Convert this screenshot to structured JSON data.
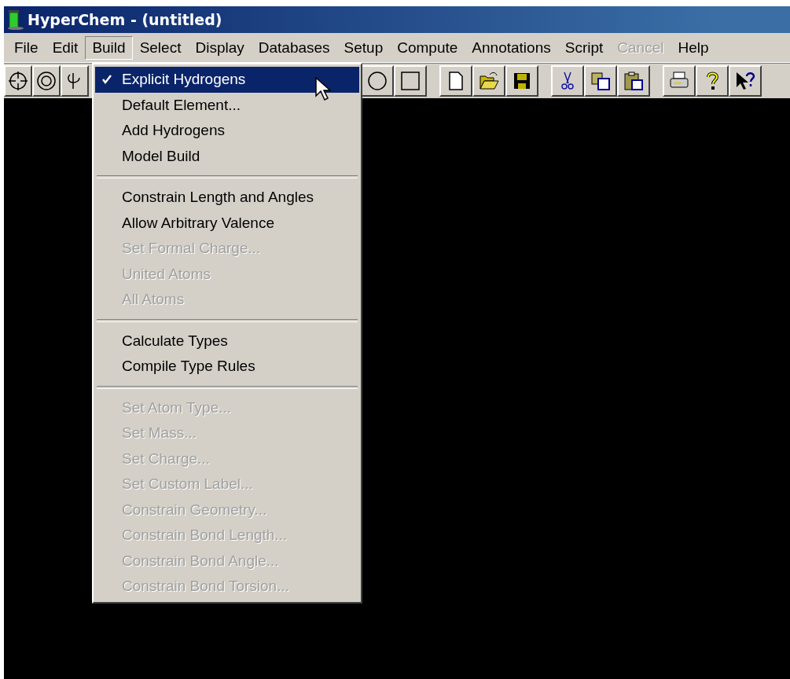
{
  "window": {
    "title": "HyperChem - (untitled)"
  },
  "menubar": [
    {
      "label": "File",
      "selected": false,
      "disabled": false
    },
    {
      "label": "Edit",
      "selected": false,
      "disabled": false
    },
    {
      "label": "Build",
      "selected": true,
      "disabled": false
    },
    {
      "label": "Select",
      "selected": false,
      "disabled": false
    },
    {
      "label": "Display",
      "selected": false,
      "disabled": false
    },
    {
      "label": "Databases",
      "selected": false,
      "disabled": false
    },
    {
      "label": "Setup",
      "selected": false,
      "disabled": false
    },
    {
      "label": "Compute",
      "selected": false,
      "disabled": false
    },
    {
      "label": "Annotations",
      "selected": false,
      "disabled": false
    },
    {
      "label": "Script",
      "selected": false,
      "disabled": false
    },
    {
      "label": "Cancel",
      "selected": false,
      "disabled": true
    },
    {
      "label": "Help",
      "selected": false,
      "disabled": false
    }
  ],
  "toolbar": {
    "groups": [
      [
        {
          "kind": "crosshair"
        },
        {
          "kind": "rings"
        },
        {
          "kind": "hook"
        }
      ],
      [
        {
          "kind": "circle"
        },
        {
          "kind": "square"
        }
      ],
      [
        {
          "kind": "new"
        },
        {
          "kind": "open"
        },
        {
          "kind": "save"
        }
      ],
      [
        {
          "kind": "cut"
        },
        {
          "kind": "copy"
        },
        {
          "kind": "paste"
        }
      ],
      [
        {
          "kind": "print"
        },
        {
          "kind": "help"
        },
        {
          "kind": "context-help"
        }
      ]
    ]
  },
  "build_menu": {
    "items": [
      {
        "kind": "item",
        "label": "Explicit Hydrogens",
        "checked": true,
        "disabled": false,
        "selected": true
      },
      {
        "kind": "item",
        "label": "Default Element...",
        "checked": false,
        "disabled": false,
        "selected": false
      },
      {
        "kind": "item",
        "label": "Add Hydrogens",
        "checked": false,
        "disabled": false,
        "selected": false
      },
      {
        "kind": "item",
        "label": "Model Build",
        "checked": false,
        "disabled": false,
        "selected": false
      },
      {
        "kind": "separator"
      },
      {
        "kind": "item",
        "label": "Constrain Length and Angles",
        "checked": false,
        "disabled": false,
        "selected": false
      },
      {
        "kind": "item",
        "label": "Allow Arbitrary Valence",
        "checked": false,
        "disabled": false,
        "selected": false
      },
      {
        "kind": "item",
        "label": "Set Formal Charge...",
        "checked": false,
        "disabled": true,
        "selected": false
      },
      {
        "kind": "item",
        "label": "United Atoms",
        "checked": false,
        "disabled": true,
        "selected": false
      },
      {
        "kind": "item",
        "label": "All Atoms",
        "checked": false,
        "disabled": true,
        "selected": false
      },
      {
        "kind": "separator"
      },
      {
        "kind": "item",
        "label": "Calculate Types",
        "checked": false,
        "disabled": false,
        "selected": false
      },
      {
        "kind": "item",
        "label": "Compile Type Rules",
        "checked": false,
        "disabled": false,
        "selected": false
      },
      {
        "kind": "separator"
      },
      {
        "kind": "item",
        "label": "Set Atom Type...",
        "checked": false,
        "disabled": true,
        "selected": false
      },
      {
        "kind": "item",
        "label": "Set Mass...",
        "checked": false,
        "disabled": true,
        "selected": false
      },
      {
        "kind": "item",
        "label": "Set Charge...",
        "checked": false,
        "disabled": true,
        "selected": false
      },
      {
        "kind": "item",
        "label": "Set Custom Label...",
        "checked": false,
        "disabled": true,
        "selected": false
      },
      {
        "kind": "item",
        "label": "Constrain Geometry...",
        "checked": false,
        "disabled": true,
        "selected": false
      },
      {
        "kind": "item",
        "label": "Constrain Bond Length...",
        "checked": false,
        "disabled": true,
        "selected": false
      },
      {
        "kind": "item",
        "label": "Constrain Bond Angle...",
        "checked": false,
        "disabled": true,
        "selected": false
      },
      {
        "kind": "item",
        "label": "Constrain Bond Torsion...",
        "checked": false,
        "disabled": true,
        "selected": false
      }
    ]
  }
}
